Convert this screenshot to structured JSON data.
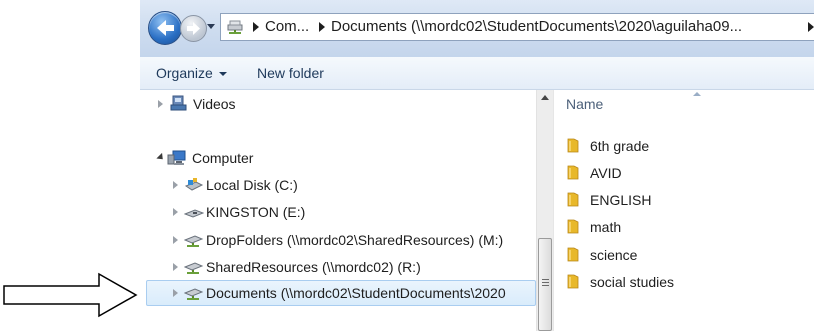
{
  "address_bar": {
    "crumbs": [
      "Com...",
      "Documents (\\\\mordc02\\StudentDocuments\\2020\\aguilaha09..."
    ]
  },
  "toolbar": {
    "organize_label": "Organize",
    "new_folder_label": "New folder"
  },
  "nav_pane": {
    "items": [
      {
        "label": "Videos",
        "icon": "video-library-icon"
      },
      {
        "label": "Computer",
        "icon": "computer-icon"
      },
      {
        "label": "Local Disk (C:)",
        "icon": "local-disk-icon"
      },
      {
        "label": "KINGSTON (E:)",
        "icon": "usb-drive-icon"
      },
      {
        "label": "DropFolders (\\\\mordc02\\SharedResources) (M:)",
        "icon": "network-drive-icon"
      },
      {
        "label": "SharedResources (\\\\mordc02) (R:)",
        "icon": "network-drive-icon"
      },
      {
        "label": "Documents (\\\\mordc02\\StudentDocuments\\2020",
        "icon": "network-drive-icon"
      }
    ]
  },
  "content": {
    "column_header": "Name",
    "files": [
      "6th grade",
      "AVID",
      "ENGLISH",
      "math",
      "science",
      "social studies"
    ]
  },
  "colors": {
    "folder": "#e8b82a",
    "selection": "#d9ecfb",
    "toolbar_text": "#1e395b"
  }
}
